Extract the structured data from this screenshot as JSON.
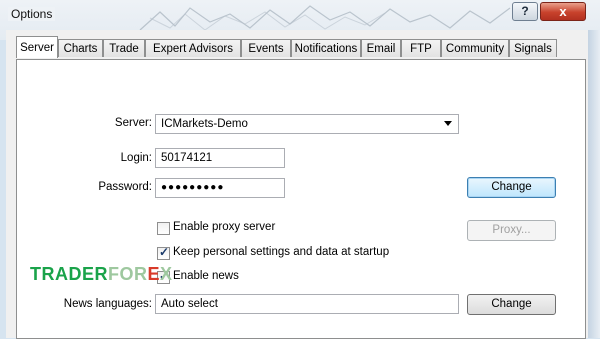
{
  "window": {
    "title": "Options",
    "help_label": "?",
    "close_label": "x"
  },
  "tabs": [
    {
      "label": "Server",
      "active": true
    },
    {
      "label": "Charts"
    },
    {
      "label": "Trade"
    },
    {
      "label": "Expert Advisors"
    },
    {
      "label": "Events"
    },
    {
      "label": "Notifications"
    },
    {
      "label": "Email"
    },
    {
      "label": "FTP"
    },
    {
      "label": "Community"
    },
    {
      "label": "Signals"
    }
  ],
  "server": {
    "server_label": "Server:",
    "server_value": "ICMarkets-Demo",
    "login_label": "Login:",
    "login_value": "50174121",
    "password_label": "Password:",
    "password_value": "●●●●●●●●●",
    "change_password_label": "Change",
    "proxy_button_label": "Proxy...",
    "news_languages_label": "News languages:",
    "news_languages_value": "Auto select",
    "change_news_label": "Change"
  },
  "checkboxes": [
    {
      "label": "Enable proxy server",
      "checked": false,
      "mark": ""
    },
    {
      "label": "Keep personal settings and data at startup",
      "checked": true,
      "mark": "✓"
    },
    {
      "label": "Enable news",
      "checked": true,
      "mark": "✓"
    }
  ],
  "watermark": {
    "part1": "TRADER",
    "part2": "FOR",
    "part3": "E",
    "part4": "X"
  },
  "colors": {
    "brand_green": "#1aa34a",
    "brand_red": "#d83a2a",
    "close_red": "#c8422c"
  }
}
